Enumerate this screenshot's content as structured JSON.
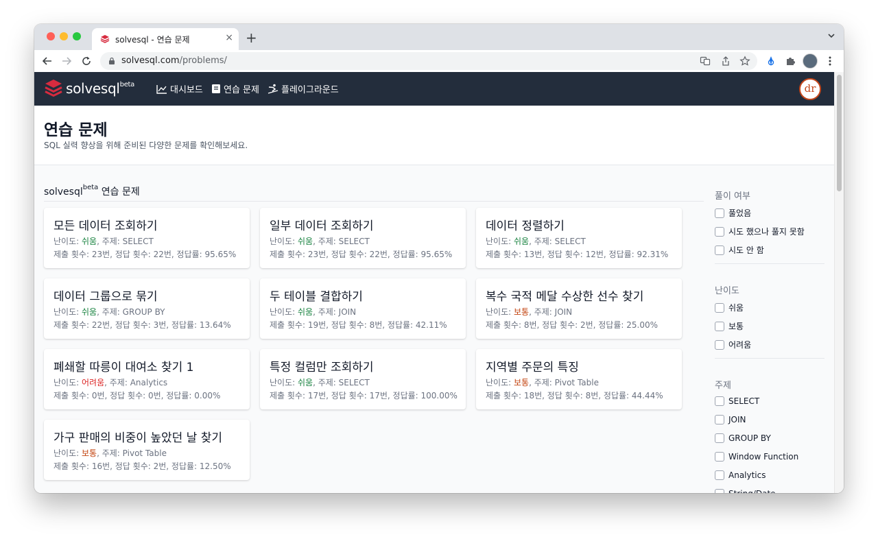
{
  "browser": {
    "tab_title": "solvesql - 연습 문제",
    "tab_close": "×",
    "new_tab": "+",
    "url_host": "solvesql.com",
    "url_path": "/problems/"
  },
  "navbar": {
    "logo_text": "solvesql",
    "logo_sup": "beta",
    "items": [
      {
        "label": "대시보드",
        "icon": "chart-line-icon"
      },
      {
        "label": "연습 문제",
        "icon": "book-icon"
      },
      {
        "label": "플레이그라운드",
        "icon": "skier-icon"
      }
    ],
    "avatar_text": "dr"
  },
  "header": {
    "title": "연습 문제",
    "subtitle": "SQL 실력 향상을 위해 준비된 다양한 문제를 확인해보세요."
  },
  "section": {
    "title": "solvesql",
    "title_sup": "beta",
    "title_suffix": " 연습 문제"
  },
  "labels": {
    "level_prefix": "난이도: ",
    "topic_prefix": ", 주제: "
  },
  "problems": [
    {
      "title": "모든 데이터 조회하기",
      "level": "쉬움",
      "level_key": "easy",
      "topic": "SELECT",
      "stats": "제출 횟수: 23번, 정답 횟수: 22번, 정답률: 95.65%"
    },
    {
      "title": "일부 데이터 조회하기",
      "level": "쉬움",
      "level_key": "easy",
      "topic": "SELECT",
      "stats": "제출 횟수: 23번, 정답 횟수: 22번, 정답률: 95.65%"
    },
    {
      "title": "데이터 정렬하기",
      "level": "쉬움",
      "level_key": "easy",
      "topic": "SELECT",
      "stats": "제출 횟수: 13번, 정답 횟수: 12번, 정답률: 92.31%"
    },
    {
      "title": "데이터 그룹으로 묶기",
      "level": "쉬움",
      "level_key": "easy",
      "topic": "GROUP BY",
      "stats": "제출 횟수: 22번, 정답 횟수: 3번, 정답률: 13.64%"
    },
    {
      "title": "두 테이블 결합하기",
      "level": "쉬움",
      "level_key": "easy",
      "topic": "JOIN",
      "stats": "제출 횟수: 19번, 정답 횟수: 8번, 정답률: 42.11%"
    },
    {
      "title": "복수 국적 메달 수상한 선수 찾기",
      "level": "보통",
      "level_key": "normal",
      "topic": "JOIN",
      "stats": "제출 횟수: 8번, 정답 횟수: 2번, 정답률: 25.00%"
    },
    {
      "title": "폐쇄할 따릉이 대여소 찾기 1",
      "level": "어려움",
      "level_key": "hard",
      "topic": "Analytics",
      "stats": "제출 횟수: 0번, 정답 횟수: 0번, 정답률: 0.00%"
    },
    {
      "title": "특정 컬럼만 조회하기",
      "level": "쉬움",
      "level_key": "easy",
      "topic": "SELECT",
      "stats": "제출 횟수: 17번, 정답 횟수: 17번, 정답률: 100.00%"
    },
    {
      "title": "지역별 주문의 특징",
      "level": "보통",
      "level_key": "normal",
      "topic": "Pivot Table",
      "stats": "제출 횟수: 18번, 정답 횟수: 8번, 정답률: 44.44%"
    },
    {
      "title": "가구 판매의 비중이 높았던 날 찾기",
      "level": "보통",
      "level_key": "normal",
      "topic": "Pivot Table",
      "stats": "제출 횟수: 16번, 정답 횟수: 2번, 정답률: 12.50%"
    }
  ],
  "filters": {
    "solved": {
      "title": "풀이 여부",
      "options": [
        "풀었음",
        "시도 했으나 풀지 못함",
        "시도 안 함"
      ]
    },
    "level": {
      "title": "난이도",
      "options": [
        "쉬움",
        "보통",
        "어려움"
      ]
    },
    "topic": {
      "title": "주제",
      "options": [
        "SELECT",
        "JOIN",
        "GROUP BY",
        "Window Function",
        "Analytics",
        "String/Date"
      ]
    }
  },
  "colors": {
    "navbar_bg": "#232d3c",
    "logo_red": "#d72b3f",
    "easy": "#15803d",
    "normal": "#c2410c",
    "hard": "#dc2626"
  }
}
